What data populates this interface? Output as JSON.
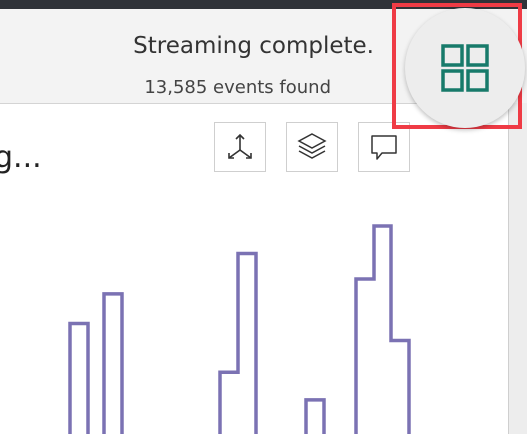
{
  "status": {
    "title": "Streaming complete.",
    "events_found": "13,585 events found"
  },
  "panel": {
    "title": "g..."
  },
  "toolbar": {
    "buttons": [
      {
        "icon": "axes-3d-icon"
      },
      {
        "icon": "layers-icon"
      },
      {
        "icon": "comment-icon"
      }
    ]
  },
  "fab": {
    "icon": "grid-view-icon",
    "color": "#177a6a"
  },
  "colors": {
    "histogram_stroke": "#7b72b3",
    "highlight_border": "#ef3b45"
  },
  "chart_data": {
    "type": "bar",
    "bars": [
      {
        "x": 0,
        "value": 0.54
      },
      {
        "x": 1,
        "value": 0.68
      },
      {
        "x": 2,
        "value": 0.31
      },
      {
        "x": 3,
        "value": 0.87
      },
      {
        "x": 4,
        "value": 0.18
      },
      {
        "x": 5,
        "value": 0.75
      },
      {
        "x": 6,
        "value": 1.0
      },
      {
        "x": 7,
        "value": 0.46
      }
    ]
  }
}
